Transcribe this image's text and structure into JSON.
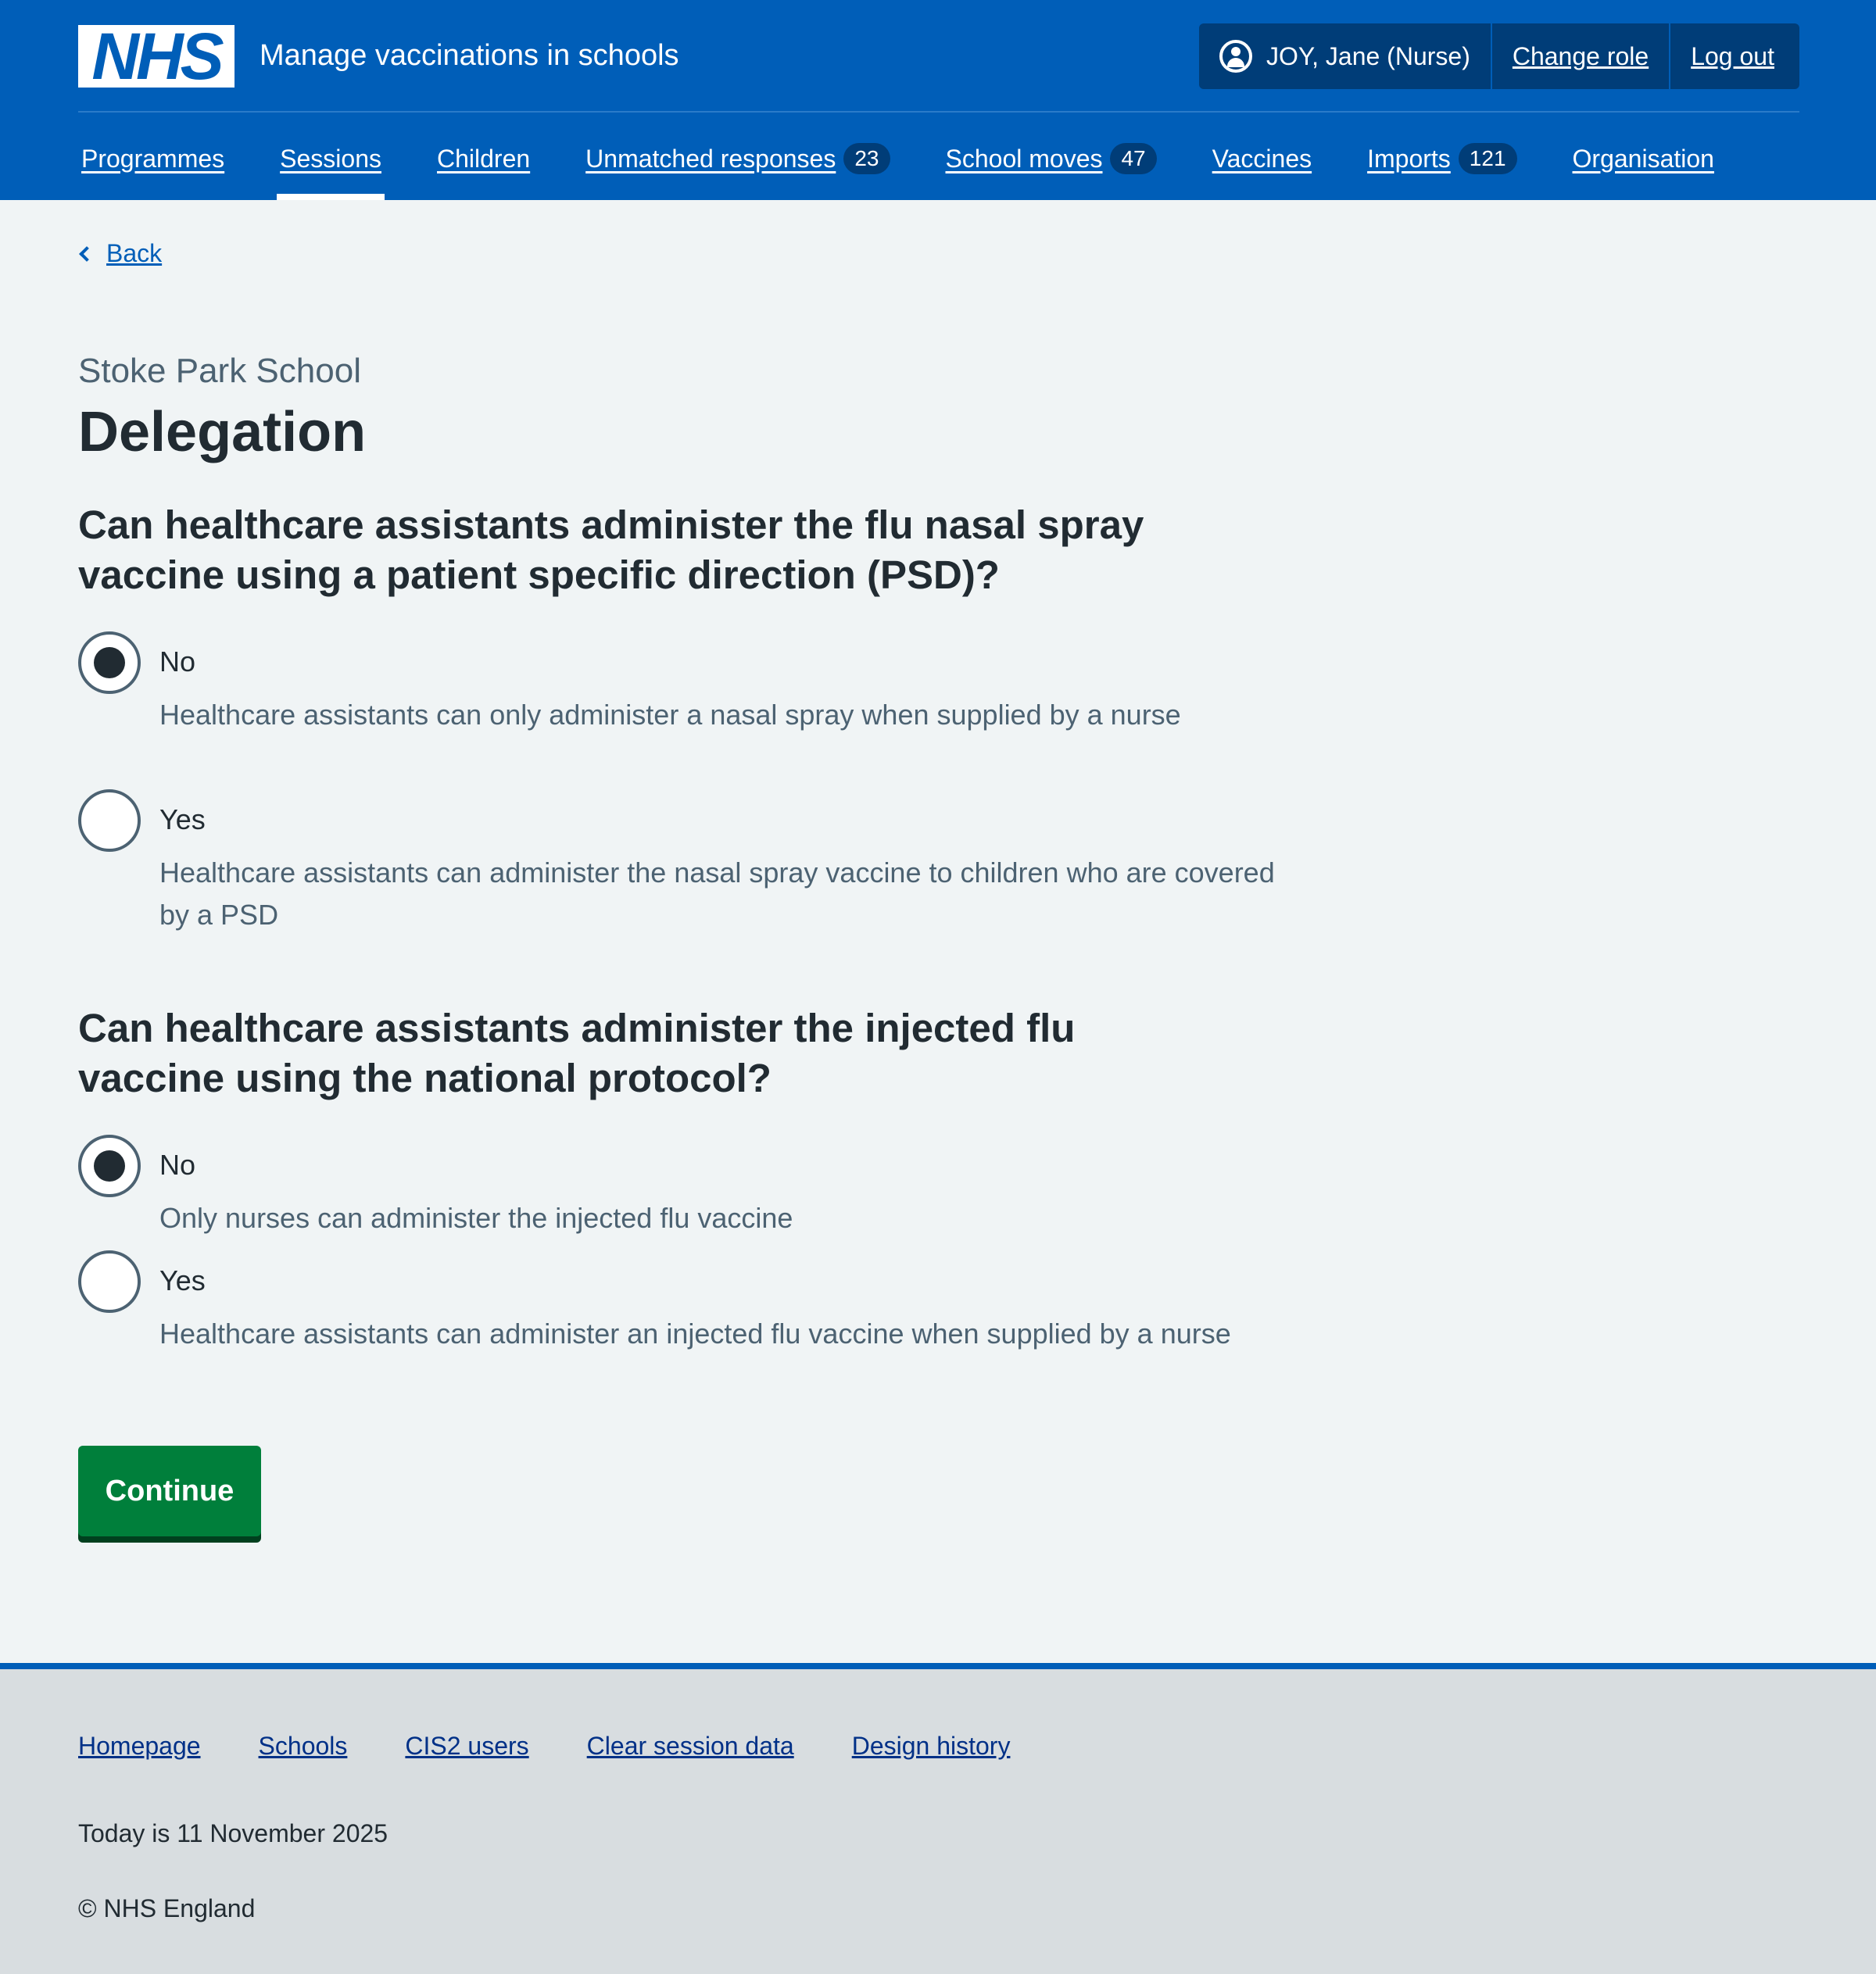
{
  "header": {
    "logo_text": "NHS",
    "service_name": "Manage vaccinations in schools",
    "account": {
      "user": "JOY, Jane (Nurse)",
      "change_role": "Change role",
      "log_out": "Log out"
    },
    "nav": [
      {
        "label": "Programmes",
        "badge": null,
        "active": false
      },
      {
        "label": "Sessions",
        "badge": null,
        "active": true
      },
      {
        "label": "Children",
        "badge": null,
        "active": false
      },
      {
        "label": "Unmatched responses",
        "badge": "23",
        "active": false
      },
      {
        "label": "School moves",
        "badge": "47",
        "active": false
      },
      {
        "label": "Vaccines",
        "badge": null,
        "active": false
      },
      {
        "label": "Imports",
        "badge": "121",
        "active": false
      },
      {
        "label": "Organisation",
        "badge": null,
        "active": false
      }
    ]
  },
  "main": {
    "back_label": "Back",
    "caption": "Stoke Park School",
    "title": "Delegation",
    "questions": [
      {
        "text": "Can healthcare assistants administer the flu nasal spray vaccine using a patient specific direction (PSD)?",
        "options": [
          {
            "label": "No",
            "hint": "Healthcare assistants can only administer a nasal spray when supplied by a nurse",
            "checked": true
          },
          {
            "label": "Yes",
            "hint": "Healthcare assistants can administer the nasal spray vaccine to children who are covered by a PSD",
            "checked": false
          }
        ]
      },
      {
        "text": "Can healthcare assistants administer the injected flu vaccine using the national protocol?",
        "options": [
          {
            "label": "No",
            "hint": "Only nurses can administer the injected flu vaccine",
            "checked": true
          },
          {
            "label": "Yes",
            "hint": "Healthcare assistants can administer an injected flu vaccine when supplied by a nurse",
            "checked": false
          }
        ]
      }
    ],
    "continue_label": "Continue"
  },
  "footer": {
    "links": [
      "Homepage",
      "Schools",
      "CIS2 users",
      "Clear session data",
      "Design history"
    ],
    "date_text": "Today is 11 November 2025",
    "copyright": "© NHS England"
  },
  "colors": {
    "brand_blue": "#005eb8",
    "dark_blue": "#003d78",
    "button_green": "#007f3b",
    "text": "#212b32",
    "secondary_text": "#4c6272",
    "page_bg": "#f0f4f5",
    "footer_bg": "#d8dde0"
  }
}
